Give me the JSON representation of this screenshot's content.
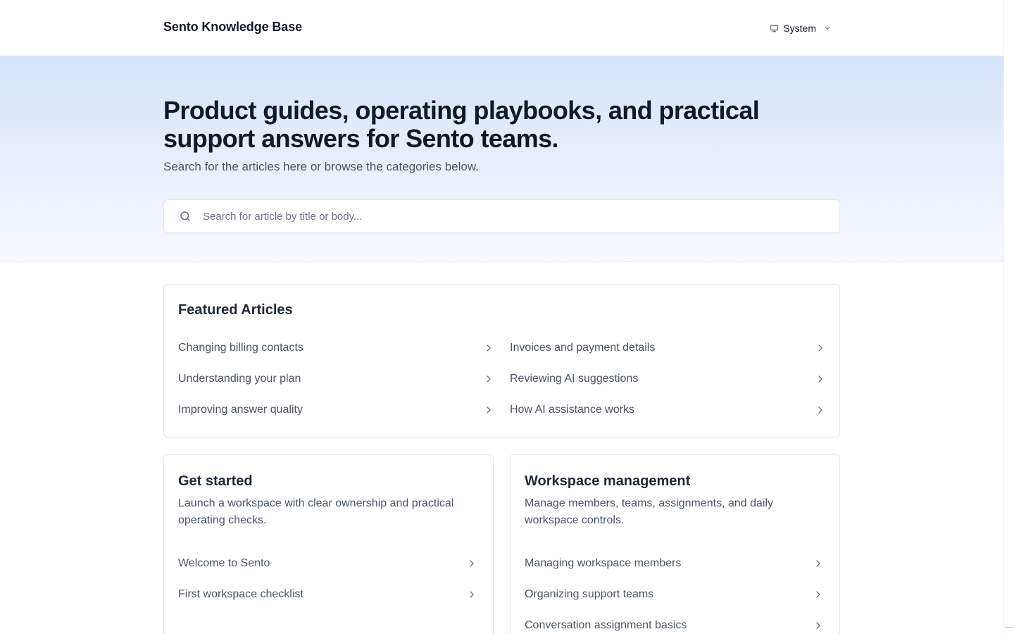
{
  "header": {
    "brand": "Sento Knowledge Base",
    "theme_label": "System",
    "theme_icon": "monitor-icon"
  },
  "hero": {
    "title": "Product guides, operating playbooks, and practical support answers for Sento teams.",
    "subtitle": "Search for the articles here or browse the categories below.",
    "search_placeholder": "Search for article by title or body...",
    "gradient_top": "#d6e2fb"
  },
  "featured": {
    "heading": "Featured Articles",
    "left": [
      {
        "label": "Changing billing contacts"
      },
      {
        "label": "Understanding your plan"
      },
      {
        "label": "Improving answer quality"
      }
    ],
    "right": [
      {
        "label": "Invoices and payment details"
      },
      {
        "label": "Reviewing AI suggestions"
      },
      {
        "label": "How AI assistance works"
      }
    ]
  },
  "categories": [
    {
      "title": "Get started",
      "description": "Launch a workspace with clear ownership and practical operating checks.",
      "articles": [
        {
          "label": "Welcome to Sento"
        },
        {
          "label": "First workspace checklist"
        }
      ]
    },
    {
      "title": "Workspace management",
      "description": "Manage members, teams, assignments, and daily workspace controls.",
      "articles": [
        {
          "label": "Managing workspace members"
        },
        {
          "label": "Organizing support teams"
        },
        {
          "label": "Conversation assignment basics"
        }
      ]
    }
  ]
}
